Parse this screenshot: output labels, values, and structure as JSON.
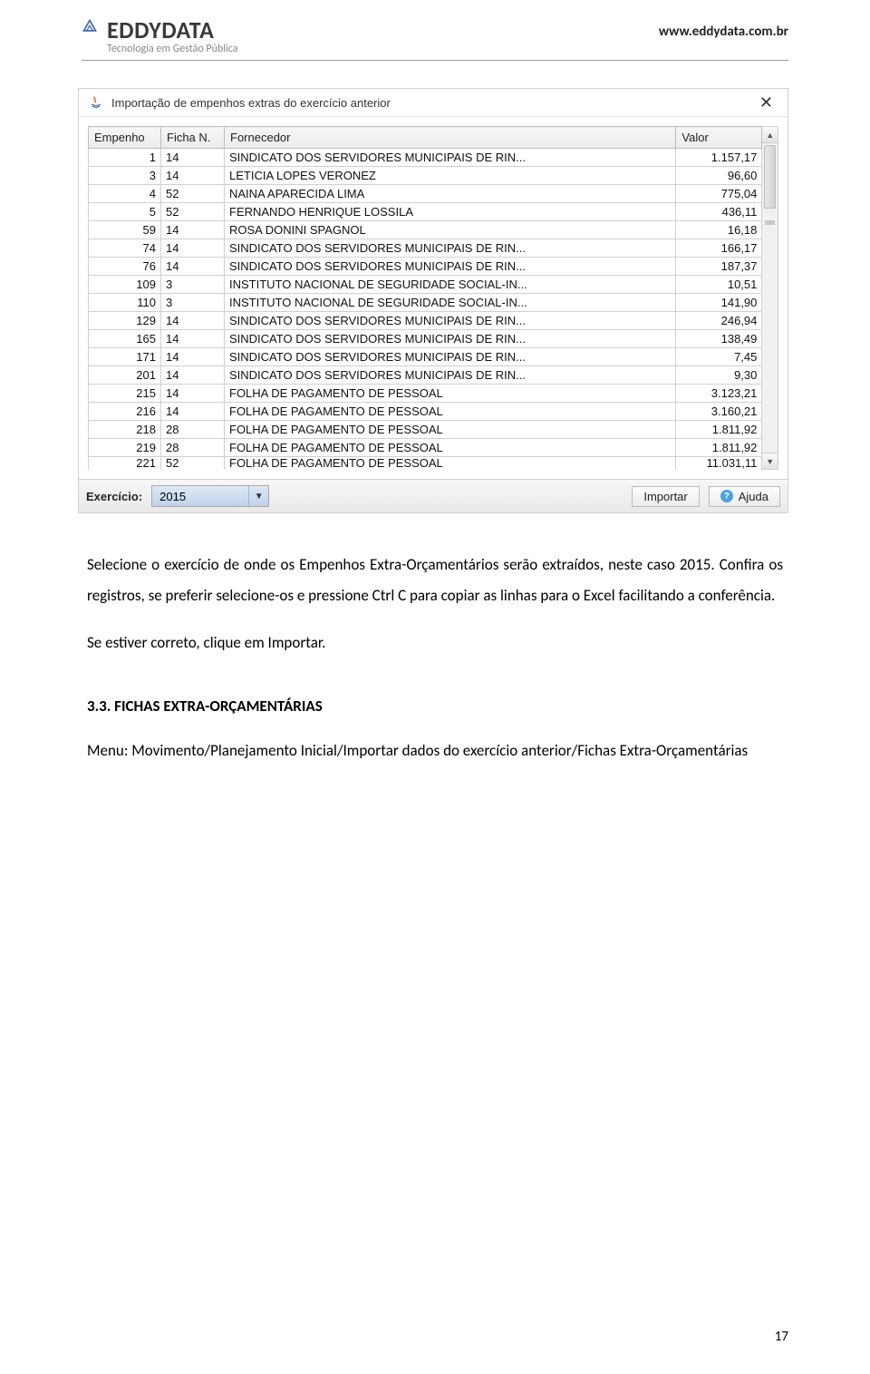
{
  "header": {
    "company": "EDDYDATA",
    "tagline": "Tecnologia em Gestão Pública",
    "url": "www.eddydata.com.br"
  },
  "window": {
    "title": "Importação de empenhos extras do exercício anterior",
    "columns": {
      "c0": "Empenho",
      "c1": "Ficha N.",
      "c2": "Fornecedor",
      "c3": "Valor"
    },
    "rows": [
      {
        "emp": "1",
        "fic": "14",
        "forn": "SINDICATO DOS SERVIDORES MUNICIPAIS DE RIN...",
        "val": "1.157,17"
      },
      {
        "emp": "3",
        "fic": "14",
        "forn": "LETICIA LOPES VERONEZ",
        "val": "96,60"
      },
      {
        "emp": "4",
        "fic": "52",
        "forn": "NAINA APARECIDA LIMA",
        "val": "775,04"
      },
      {
        "emp": "5",
        "fic": "52",
        "forn": "FERNANDO HENRIQUE LOSSILA",
        "val": "436,11"
      },
      {
        "emp": "59",
        "fic": "14",
        "forn": "ROSA DONINI SPAGNOL",
        "val": "16,18"
      },
      {
        "emp": "74",
        "fic": "14",
        "forn": "SINDICATO DOS SERVIDORES MUNICIPAIS DE RIN...",
        "val": "166,17"
      },
      {
        "emp": "76",
        "fic": "14",
        "forn": "SINDICATO DOS SERVIDORES MUNICIPAIS DE RIN...",
        "val": "187,37"
      },
      {
        "emp": "109",
        "fic": "3",
        "forn": "INSTITUTO NACIONAL DE SEGURIDADE SOCIAL-IN...",
        "val": "10,51"
      },
      {
        "emp": "110",
        "fic": "3",
        "forn": "INSTITUTO NACIONAL DE SEGURIDADE SOCIAL-IN...",
        "val": "141,90"
      },
      {
        "emp": "129",
        "fic": "14",
        "forn": "SINDICATO DOS SERVIDORES MUNICIPAIS DE RIN...",
        "val": "246,94"
      },
      {
        "emp": "165",
        "fic": "14",
        "forn": "SINDICATO DOS SERVIDORES MUNICIPAIS DE RIN...",
        "val": "138,49"
      },
      {
        "emp": "171",
        "fic": "14",
        "forn": "SINDICATO DOS SERVIDORES MUNICIPAIS DE RIN...",
        "val": "7,45"
      },
      {
        "emp": "201",
        "fic": "14",
        "forn": "SINDICATO DOS SERVIDORES MUNICIPAIS DE RIN...",
        "val": "9,30"
      },
      {
        "emp": "215",
        "fic": "14",
        "forn": "FOLHA DE PAGAMENTO DE PESSOAL",
        "val": "3.123,21"
      },
      {
        "emp": "216",
        "fic": "14",
        "forn": "FOLHA DE PAGAMENTO DE PESSOAL",
        "val": "3.160,21"
      },
      {
        "emp": "218",
        "fic": "28",
        "forn": "FOLHA DE PAGAMENTO DE PESSOAL",
        "val": "1.811,92"
      },
      {
        "emp": "219",
        "fic": "28",
        "forn": "FOLHA DE PAGAMENTO DE PESSOAL",
        "val": "1.811,92"
      }
    ],
    "partial_row": {
      "emp": "221",
      "fic": "52",
      "forn": "FOLHA DE PAGAMENTO DE PESSOAL",
      "val": "11.031,11"
    },
    "footer": {
      "exercicio_label": "Exercício:",
      "exercicio_value": "2015",
      "importar": "Importar",
      "ajuda": "Ajuda"
    }
  },
  "body": {
    "p1": "Selecione o exercício de onde os Empenhos Extra-Orçamentários serão extraídos, neste caso 2015. Confira os registros, se preferir selecione-os e pressione Ctrl C para copiar as linhas para o Excel facilitando a conferência.",
    "p2": "Se estiver correto, clique em Importar.",
    "section_heading": "3.3. FICHAS EXTRA-ORÇAMENTÁRIAS",
    "p3": "Menu: Movimento/Planejamento Inicial/Importar dados do exercício anterior/Fichas Extra-Orçamentárias"
  },
  "page_number": "17"
}
